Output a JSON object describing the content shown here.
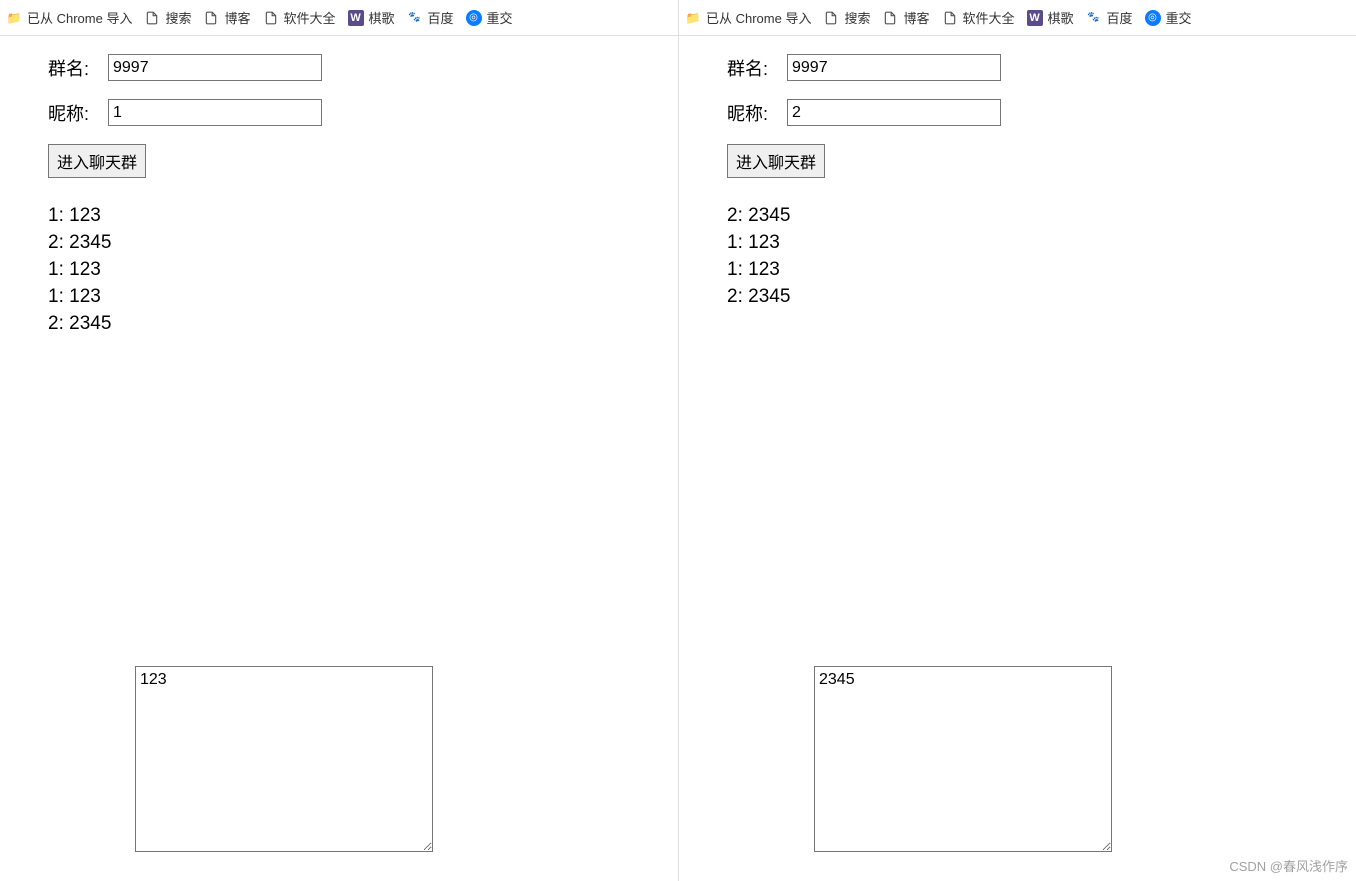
{
  "bookmarks": [
    {
      "icon": "folder",
      "label": "已从 Chrome 导入"
    },
    {
      "icon": "file",
      "label": "搜索"
    },
    {
      "icon": "file",
      "label": "博客"
    },
    {
      "icon": "file",
      "label": "软件大全"
    },
    {
      "icon": "w",
      "label": "棋歌"
    },
    {
      "icon": "baidu",
      "label": "百度"
    },
    {
      "icon": "blue",
      "label": "重交"
    }
  ],
  "form": {
    "group_label": "群名:",
    "nick_label": "昵称:",
    "enter_label": "进入聊天群"
  },
  "windows": [
    {
      "group_value": "9997",
      "nick_value": "1",
      "messages": [
        {
          "user": "1",
          "text": "123"
        },
        {
          "user": "2",
          "text": "2345"
        },
        {
          "user": "1",
          "text": "123"
        },
        {
          "user": "1",
          "text": "123"
        },
        {
          "user": "2",
          "text": "2345"
        }
      ],
      "textarea_value": "123"
    },
    {
      "group_value": "9997",
      "nick_value": "2",
      "messages": [
        {
          "user": "2",
          "text": "2345"
        },
        {
          "user": "1",
          "text": "123"
        },
        {
          "user": "1",
          "text": "123"
        },
        {
          "user": "2",
          "text": "2345"
        }
      ],
      "textarea_value": "2345"
    }
  ],
  "watermark": "CSDN @春风浅作序"
}
